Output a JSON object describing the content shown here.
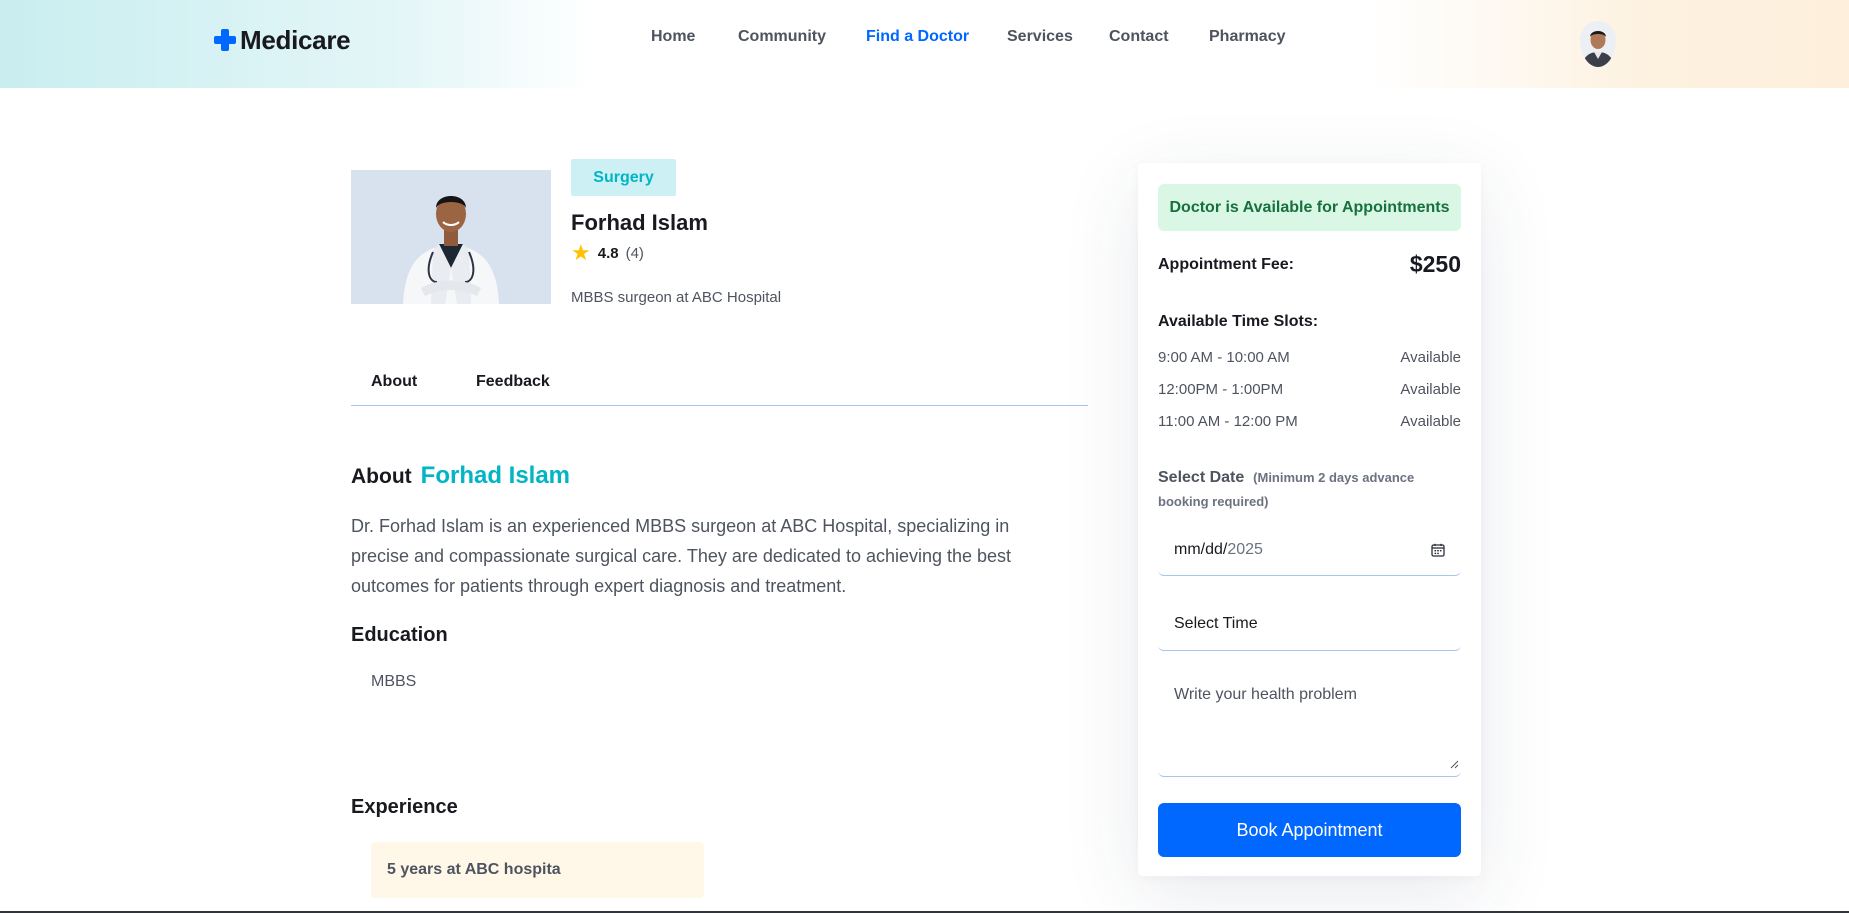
{
  "header": {
    "logo_text": "Medicare",
    "nav": [
      {
        "label": "Home",
        "active": false
      },
      {
        "label": "Community",
        "active": false
      },
      {
        "label": "Find a Doctor",
        "active": true
      },
      {
        "label": "Services",
        "active": false
      },
      {
        "label": "Contact",
        "active": false
      },
      {
        "label": "Pharmacy",
        "active": false
      }
    ]
  },
  "doctor": {
    "specialty": "Surgery",
    "name": "Forhad Islam",
    "rating": "4.8",
    "rating_count": "(4)",
    "title": "MBBS surgeon at ABC Hospital"
  },
  "tabs": {
    "about": "About",
    "feedback": "Feedback"
  },
  "about": {
    "heading_label": "About",
    "heading_name": "Forhad Islam",
    "text": "Dr. Forhad Islam is an experienced MBBS surgeon at ABC Hospital, specializing in precise and compassionate surgical care. They are dedicated to achieving the best outcomes for patients through expert diagnosis and treatment.",
    "education_heading": "Education",
    "education": [
      "MBBS"
    ],
    "experience_heading": "Experience",
    "experience": [
      "5 years at ABC hospita"
    ]
  },
  "booking": {
    "availability": "Doctor is Available for Appointments",
    "fee_label": "Appointment Fee:",
    "fee_value": "$250",
    "slots_title": "Available Time Slots:",
    "slots": [
      {
        "time": "9:00 AM - 10:00 AM",
        "status": "Available"
      },
      {
        "time": "12:00PM - 1:00PM",
        "status": "Available"
      },
      {
        "time": "11:00 AM - 12:00 PM",
        "status": "Available"
      }
    ],
    "date_label": "Select Date",
    "date_note": "(Minimum 2 days advance booking required)",
    "date_placeholder": "mm/dd/",
    "date_year": "2025",
    "time_placeholder": "Select Time",
    "problem_placeholder": "Write your health problem",
    "book_button": "Book Appointment"
  },
  "colors": {
    "primary": "#0067ff",
    "teal": "#01b5c5",
    "success_bg": "#d9f7e4",
    "success_text": "#17703d",
    "star": "#fec200"
  }
}
